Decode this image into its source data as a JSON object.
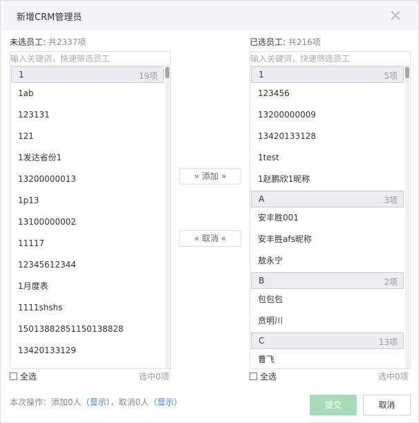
{
  "dialog": {
    "title": "新增CRM管理员",
    "close_icon": "close-icon"
  },
  "left_panel": {
    "label": "未选员工:",
    "count": "共2337项",
    "search_placeholder": "输入关键词，快速筛选员工",
    "group": {
      "name": "1",
      "count": "19项"
    },
    "items": [
      "1ab",
      "123131",
      "121",
      "1发达省份1",
      "13200000013",
      "1p13",
      "13100000002",
      "11117",
      "12345612344",
      "1月度表",
      "1111shshs",
      "15013882851150138828",
      "13420133129"
    ],
    "select_all": "全选",
    "selected_count": "选中0项"
  },
  "right_panel": {
    "label": "已选员工:",
    "count": "共216项",
    "search_placeholder": "输入关键词，快速筛选员工",
    "groups": [
      {
        "name": "1",
        "count": "5项",
        "items": [
          "123456",
          "13200000009",
          "13420133128",
          "1test",
          "1赵鹏欣1昵称"
        ]
      },
      {
        "name": "A",
        "count": "3项",
        "items": [
          "安丰胜001",
          "安丰胜afs昵称",
          "敖永宁"
        ]
      },
      {
        "name": "B",
        "count": "2项",
        "items": [
          "包包包",
          "贲明川"
        ]
      },
      {
        "name": "C",
        "count": "13项",
        "items": [
          "曹飞"
        ]
      }
    ],
    "select_all": "全选",
    "selected_count": "选中0项"
  },
  "transfer": {
    "add": "» 添加 »",
    "remove": "« 取消 «"
  },
  "ops": {
    "prefix": "本次操作：添加0人",
    "show1": "（显示）",
    "middle": "，取消0人",
    "show2": "（显示）"
  },
  "buttons": {
    "submit": "提交",
    "cancel": "取消"
  },
  "colors": {
    "submit_bg": "#a8dcb8",
    "link": "#3a7bd5"
  }
}
